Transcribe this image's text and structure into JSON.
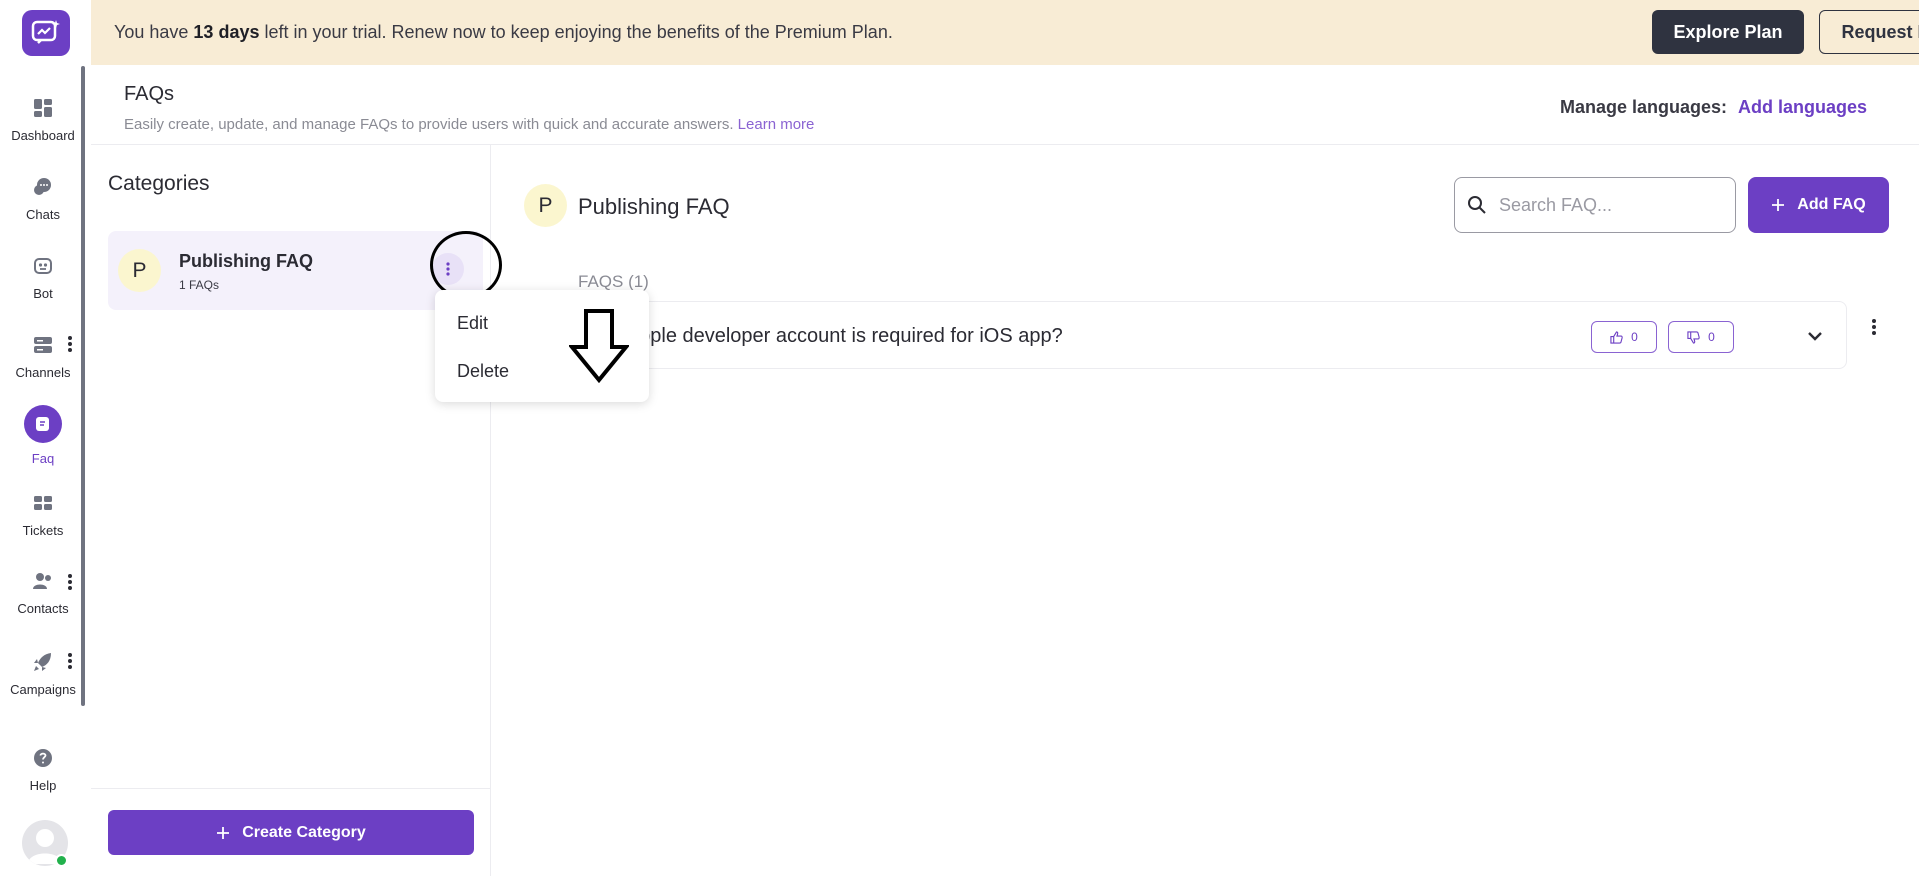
{
  "sidebar": {
    "items": [
      {
        "label": "Dashboard",
        "icon": "dashboard-icon"
      },
      {
        "label": "Chats",
        "icon": "chat-icon"
      },
      {
        "label": "Bot",
        "icon": "bot-icon"
      },
      {
        "label": "Channels",
        "icon": "channels-icon"
      },
      {
        "label": "Faq",
        "icon": "faq-icon",
        "active": true
      },
      {
        "label": "Tickets",
        "icon": "tickets-icon"
      },
      {
        "label": "Contacts",
        "icon": "contacts-icon"
      },
      {
        "label": "Campaigns",
        "icon": "campaigns-icon"
      },
      {
        "label": "Help",
        "icon": "help-icon"
      }
    ]
  },
  "banner": {
    "text_prefix": "You have ",
    "days": "13 days",
    "text_suffix": " left in your trial. Renew now to keep enjoying the benefits of the Premium Plan.",
    "explore_label": "Explore Plan",
    "demo_label": "Request Demo"
  },
  "header": {
    "title": "FAQs",
    "subtitle": "Easily create, update, and manage FAQs to provide users with quick and accurate answers.",
    "learn_more": "Learn more",
    "manage_languages": "Manage languages:",
    "add_languages": "Add languages"
  },
  "categories": {
    "title": "Categories",
    "items": [
      {
        "initial": "P",
        "name": "Publishing FAQ",
        "count": "1 FAQs"
      }
    ],
    "create_label": "Create Category"
  },
  "menu": {
    "edit": "Edit",
    "delete": "Delete"
  },
  "main": {
    "initial": "P",
    "title": "Publishing FAQ",
    "search_placeholder": "Search FAQ...",
    "add_faq_label": "Add FAQ",
    "faqs_count": "FAQS (1)",
    "faqs": [
      {
        "question": "Is apple developer account is required for iOS app?",
        "question_visible": "apple developer account is required for iOS app?",
        "likes": "0",
        "dislikes": "0"
      }
    ]
  },
  "colors": {
    "accent": "#6c3fc4",
    "banner_bg": "#f8ecd5",
    "dark_button": "#2f3340"
  }
}
